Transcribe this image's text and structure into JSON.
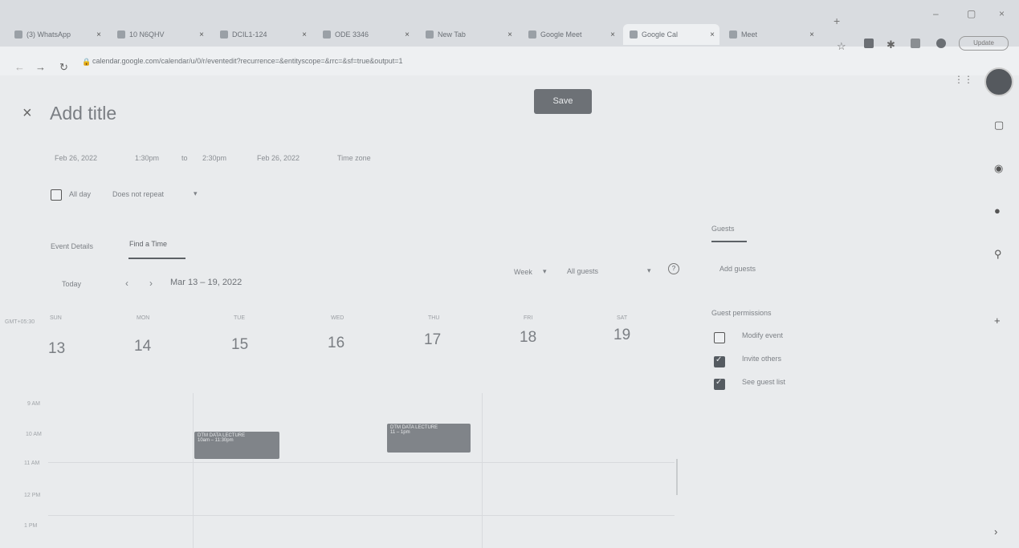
{
  "browser": {
    "tabs": [
      {
        "label": "(3) WhatsApp"
      },
      {
        "label": "10 N6QHV"
      },
      {
        "label": "DCIL1-124"
      },
      {
        "label": "ODE 3346"
      },
      {
        "label": "New Tab"
      },
      {
        "label": "Google Meet"
      },
      {
        "label": "Google Cal"
      },
      {
        "label": "Meet"
      }
    ],
    "url": "calendar.google.com/calendar/u/0/r/eventedit?recurrence=&entityscope=&rrc=&sf=true&output=1",
    "profile_button": "Update"
  },
  "event": {
    "close_icon": "×",
    "title_placeholder": "Add title",
    "save_label": "Save",
    "start_date": "Feb 26, 2022",
    "start_time": "1:30pm",
    "to_label": "to",
    "end_time": "2:30pm",
    "end_date": "Feb 26, 2022",
    "timezone_label": "Time zone",
    "all_day_label": "All day",
    "repeat_label": "Does not repeat",
    "tabs": {
      "details": "Event Details",
      "find_time": "Find a Time"
    }
  },
  "find_time": {
    "today_label": "Today",
    "prev_icon": "‹",
    "next_icon": "›",
    "date_range": "Mar 13 – 19, 2022",
    "view_select": "Week",
    "guests_select": "All guests",
    "help_icon": "?",
    "tz_label": "GMT+05:30",
    "days": [
      {
        "abbr": "SUN",
        "num": "13"
      },
      {
        "abbr": "MON",
        "num": "14"
      },
      {
        "abbr": "TUE",
        "num": "15"
      },
      {
        "abbr": "WED",
        "num": "16"
      },
      {
        "abbr": "THU",
        "num": "17"
      },
      {
        "abbr": "FRI",
        "num": "18"
      },
      {
        "abbr": "SAT",
        "num": "19"
      }
    ],
    "times": [
      "9 AM",
      "10 AM",
      "11 AM",
      "12 PM",
      "1 PM"
    ],
    "events": [
      {
        "title": "DTM DATA LECTURE",
        "time": "10am – 11:30pm"
      },
      {
        "title": "DTM DATA LECTURE",
        "time": "11 – 1pm"
      }
    ]
  },
  "guests": {
    "tab_label": "Guests",
    "add_placeholder": "Add guests",
    "permissions_label": "Guest permissions",
    "permissions": [
      {
        "label": "Modify event",
        "checked": false
      },
      {
        "label": "Invite others",
        "checked": true
      },
      {
        "label": "See guest list",
        "checked": true
      }
    ]
  }
}
